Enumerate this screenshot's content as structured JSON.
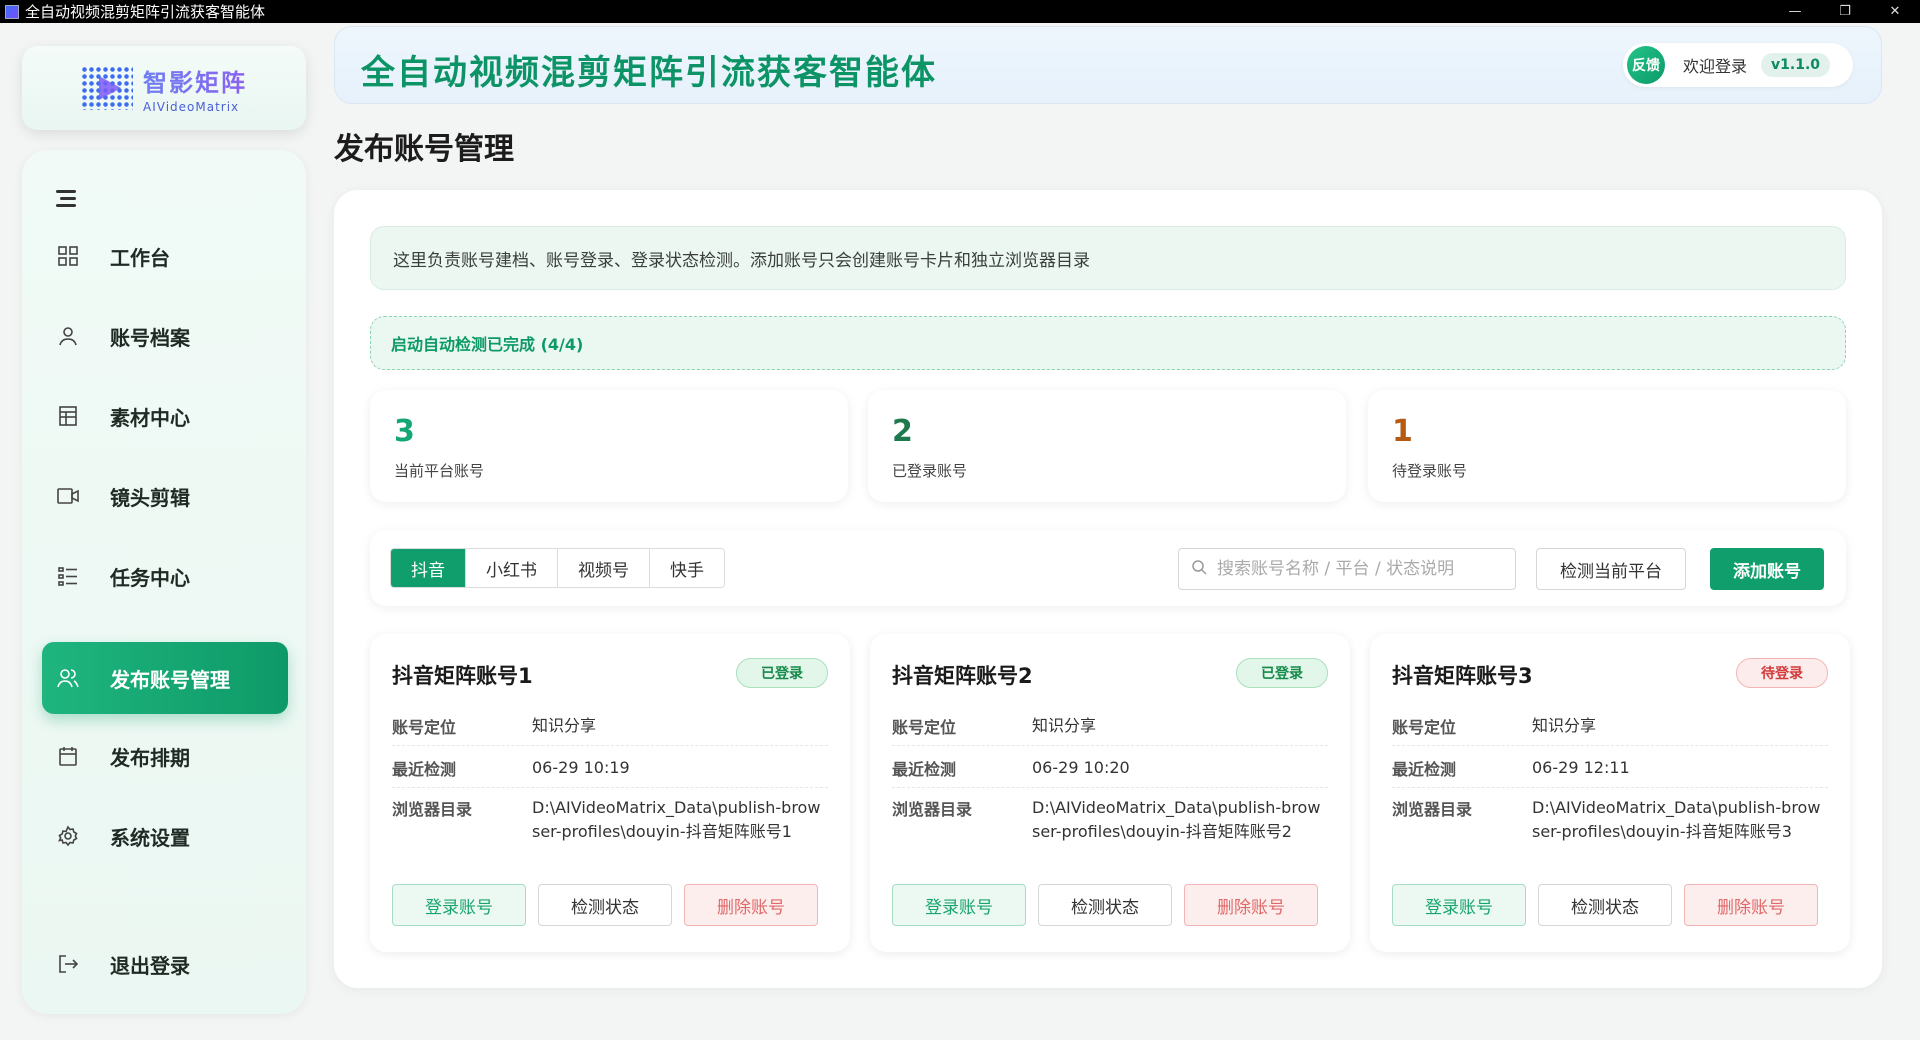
{
  "window": {
    "title": "全自动视频混剪矩阵引流获客智能体",
    "minimize": "—",
    "maximize": "❐",
    "close": "✕"
  },
  "logo": {
    "cn": "智影矩阵",
    "en": "AIVideoMatrix"
  },
  "sidebar": {
    "items": [
      {
        "label": "工作台",
        "icon": "grid-icon"
      },
      {
        "label": "账号档案",
        "icon": "user-icon"
      },
      {
        "label": "素材中心",
        "icon": "table-icon"
      },
      {
        "label": "镜头剪辑",
        "icon": "video-camera-icon"
      },
      {
        "label": "任务中心",
        "icon": "list-icon"
      },
      {
        "label": "发布账号管理",
        "icon": "users-icon"
      },
      {
        "label": "发布排期",
        "icon": "calendar-icon"
      },
      {
        "label": "系统设置",
        "icon": "gear-icon"
      }
    ],
    "active_index": 5,
    "logout": "退出登录"
  },
  "header": {
    "title": "全自动视频混剪矩阵引流获客智能体",
    "feedback": "反馈",
    "welcome": "欢迎登录",
    "version": "v1.1.0"
  },
  "page": {
    "title": "发布账号管理"
  },
  "main": {
    "info": "这里负责账号建档、账号登录、登录状态检测。添加账号只会创建账号卡片和独立浏览器目录",
    "status": "启动自动检测已完成 (4/4)",
    "stats": [
      {
        "num": "3",
        "label": "当前平台账号",
        "color": "#14a673"
      },
      {
        "num": "2",
        "label": "已登录账号",
        "color": "#1e7a4c"
      },
      {
        "num": "1",
        "label": "待登录账号",
        "color": "#b55a12"
      }
    ],
    "tabs": [
      "抖音",
      "小红书",
      "视频号",
      "快手"
    ],
    "search_placeholder": "搜索账号名称 / 平台 / 状态说明",
    "check_platform": "检测当前平台",
    "add_account": "添加账号",
    "accounts": [
      {
        "name": "抖音矩阵账号1",
        "status": "已登录",
        "positioning_label": "账号定位",
        "positioning": "知识分享",
        "checked_label": "最近检测",
        "checked": "06-29 10:19",
        "dir_label": "浏览器目录",
        "dir": "D:\\AIVideoMatrix_Data\\publish-browser-profiles\\douyin-抖音矩阵账号1",
        "login": "登录账号",
        "check": "检测状态",
        "delete": "删除账号"
      },
      {
        "name": "抖音矩阵账号2",
        "status": "已登录",
        "positioning_label": "账号定位",
        "positioning": "知识分享",
        "checked_label": "最近检测",
        "checked": "06-29 10:20",
        "dir_label": "浏览器目录",
        "dir": "D:\\AIVideoMatrix_Data\\publish-browser-profiles\\douyin-抖音矩阵账号2",
        "login": "登录账号",
        "check": "检测状态",
        "delete": "删除账号"
      },
      {
        "name": "抖音矩阵账号3",
        "status": "待登录",
        "positioning_label": "账号定位",
        "positioning": "知识分享",
        "checked_label": "最近检测",
        "checked": "06-29 12:11",
        "dir_label": "浏览器目录",
        "dir": "D:\\AIVideoMatrix_Data\\publish-browser-profiles\\douyin-抖音矩阵账号3",
        "login": "登录账号",
        "check": "检测状态",
        "delete": "删除账号"
      }
    ]
  }
}
